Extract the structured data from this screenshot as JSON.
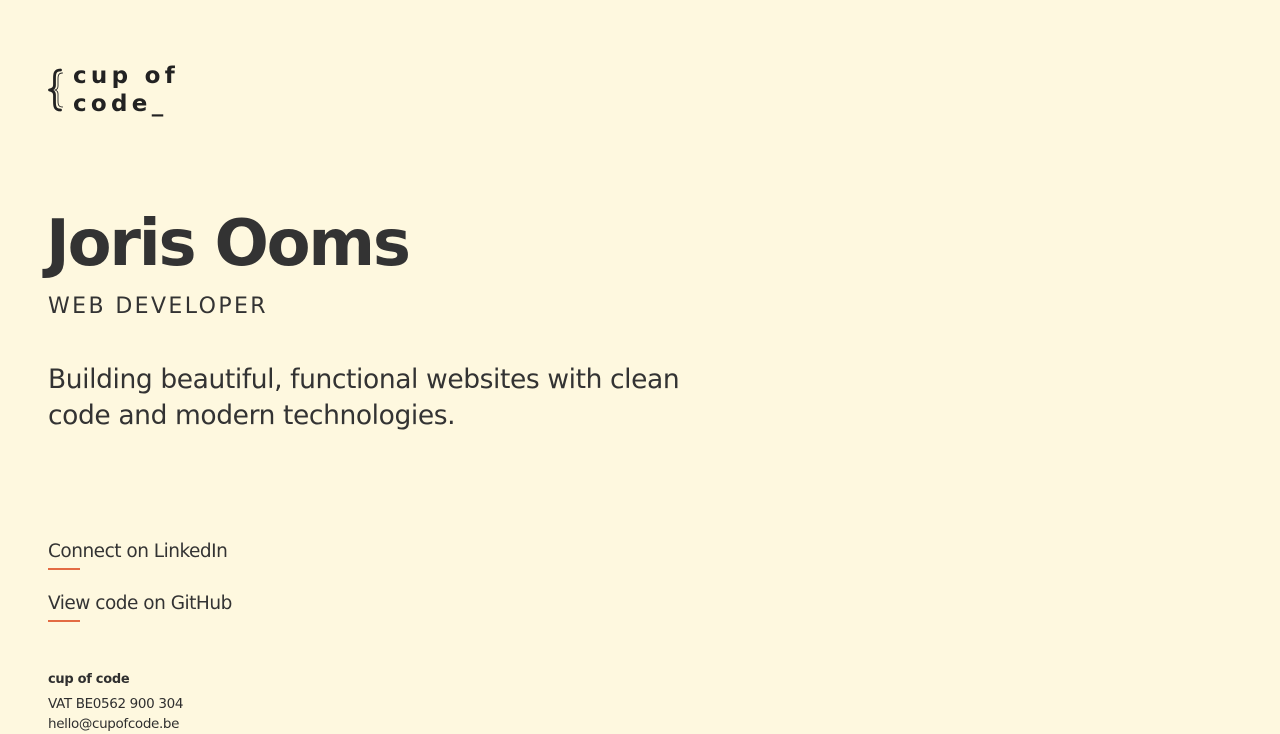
{
  "brand": {
    "logo_icon": "curly-brace-icon",
    "logo_line_1": "cup of",
    "logo_line_2": "code_"
  },
  "hero": {
    "name": "Joris Ooms",
    "role": "WEB DEVELOPER",
    "tagline": "Building beautiful, functional websites with clean code and modern technologies."
  },
  "links": [
    {
      "label": "Connect on LinkedIn"
    },
    {
      "label": "View code on GitHub"
    }
  ],
  "footer": {
    "company": "cup of code",
    "vat": "VAT BE0562 900 304",
    "email": "hello@cupofcode.be"
  },
  "colors": {
    "background": "#fef8df",
    "text": "#333333",
    "accent": "#e36b43"
  }
}
